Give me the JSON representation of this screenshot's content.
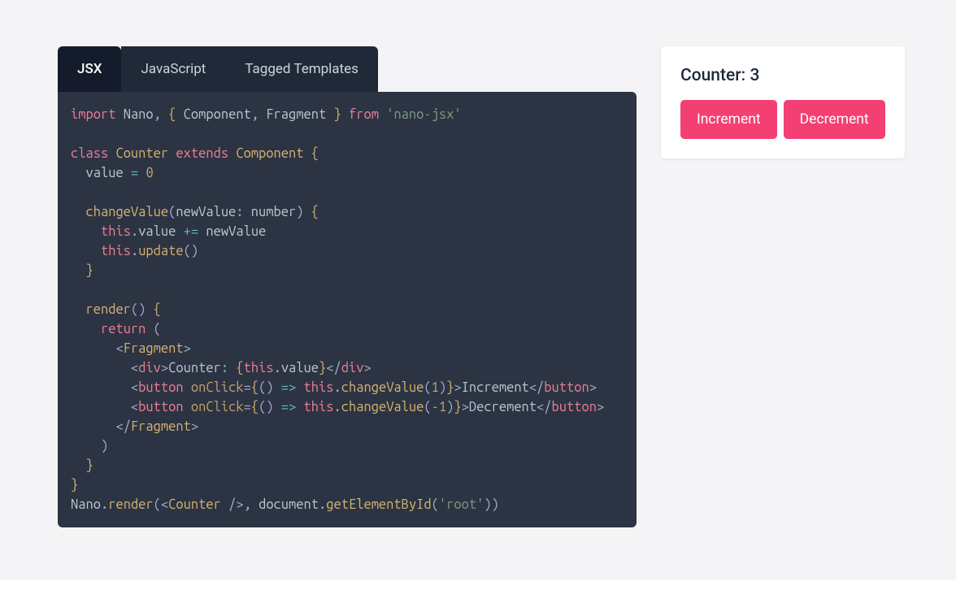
{
  "tabs": [
    {
      "label": "JSX",
      "active": true
    },
    {
      "label": "JavaScript",
      "active": false
    },
    {
      "label": "Tagged Templates",
      "active": false
    }
  ],
  "code": {
    "raw": "import Nano, { Component, Fragment } from 'nano-jsx'\n\nclass Counter extends Component {\n  value = 0\n\n  changeValue(newValue: number) {\n    this.value += newValue\n    this.update()\n  }\n\n  render() {\n    return (\n      <Fragment>\n        <div>Counter: {this.value}</div>\n        <button onClick={() => this.changeValue(1)}>Increment</button>\n        <button onClick={() => this.changeValue(-1)}>Decrement</button>\n      </Fragment>\n    )\n  }\n}\nNano.render(<Counter />, document.getElementById('root'))",
    "strings": {
      "lib": "'nano-jsx'",
      "root": "'root'"
    },
    "identifiers": {
      "Nano": "Nano",
      "Component": "Component",
      "Fragment": "Fragment",
      "Counter": "Counter",
      "value": "value",
      "newValue": "newValue",
      "number": "number",
      "changeValue": "changeValue",
      "update": "update",
      "render": "render",
      "document": "document",
      "getElementById": "getElementById",
      "onClick": "onClick",
      "div": "div",
      "button": "button"
    },
    "keywords": {
      "import": "import",
      "from": "from",
      "class": "class",
      "extends": "extends",
      "return": "return",
      "this": "this"
    },
    "numbers": {
      "zero": "0",
      "one": "1",
      "negOne": "-1"
    },
    "text": {
      "CounterColon": "Counter:",
      "Increment": "Increment",
      "Decrement": "Decrement"
    }
  },
  "result": {
    "label_prefix": "Counter:",
    "value": "3",
    "buttons": {
      "increment": "Increment",
      "decrement": "Decrement"
    }
  }
}
